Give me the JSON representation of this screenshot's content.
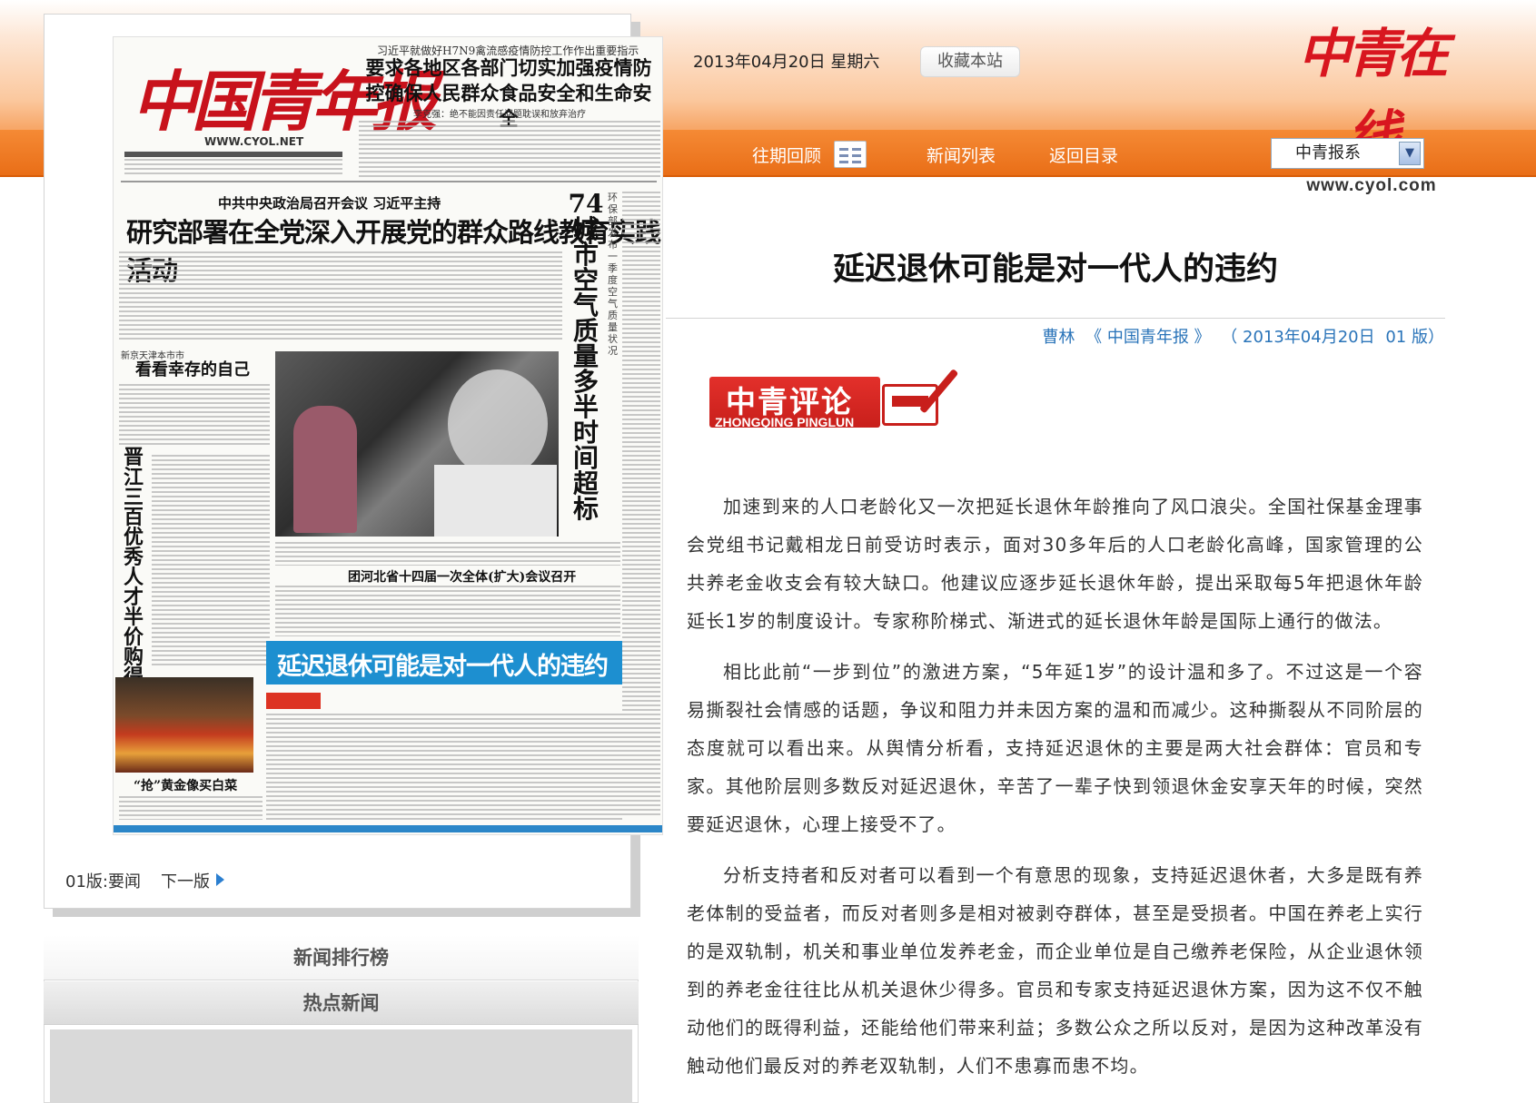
{
  "header": {
    "date": "2013年04月20日  星期六",
    "bookmark_label": "收藏本站",
    "logo_text": "中青在线",
    "logo_url": "www.cyol.com"
  },
  "nav": {
    "items": [
      "往期回顾",
      "新闻列表",
      "返回目录"
    ],
    "select_value": "中青报系"
  },
  "front_page": {
    "masthead": "中国青年报",
    "masthead_url": "WWW.CYOL.NET",
    "lead_kicker": "习近平就做好H7N9禽流感疫情防控工作作出重要指示",
    "lead_headline": "要求各地区各部门切实加强疫情防控确保人民群众食品安全和生命安全",
    "lead_sub": "李克强：绝不能因责任问题耽误和放弃治疗",
    "section_kicker": "中共中央政治局召开会议 习近平主持",
    "section_headline": "研究部署在全党深入开展党的群众路线教育实践活动",
    "side_headline": "74城市空气质量多半时间超标",
    "side_small": "环保部发布一季度空气质量状况",
    "sub_kicker": "新京天津本市市",
    "sub_headline": "看看幸存的自己",
    "left_vertical": "晋江三百优秀人才半价购得保障房",
    "mid_headline": "团河北省十四届一次全体(扩大)会议召开",
    "banner_headline": "延迟退休可能是对一代人的违约",
    "market_caption": "“抢”黄金像买白菜"
  },
  "page_nav": {
    "current": "01版:要闻",
    "next": "下一版"
  },
  "sidebar": {
    "ranking_title": "新闻排行榜",
    "hot_title": "热点新闻"
  },
  "article": {
    "title": "延迟退休可能是对一代人的违约",
    "byline": {
      "author": "曹林",
      "source": "《 中国青年报 》",
      "date": "（ 2013年04月20日",
      "page": "01 版）"
    },
    "logo_cn": "中青评论",
    "logo_pinyin": "ZHONGQING PINGLUN",
    "paragraphs": [
      "加速到来的人口老龄化又一次把延长退休年龄推向了风口浪尖。全国社保基金理事会党组书记戴相龙日前受访时表示，面对30多年后的人口老龄化高峰，国家管理的公共养老金收支会有较大缺口。他建议应逐步延长退休年龄，提出采取每5年把退休年龄延长1岁的制度设计。专家称阶梯式、渐进式的延长退休年龄是国际上通行的做法。",
      "相比此前“一步到位”的激进方案，“5年延1岁”的设计温和多了。不过这是一个容易撕裂社会情感的话题，争议和阻力并未因方案的温和而减少。这种撕裂从不同阶层的态度就可以看出来。从舆情分析看，支持延迟退休的主要是两大社会群体：官员和专家。其他阶层则多数反对延迟退休，辛苦了一辈子快到领退休金安享天年的时候，突然要延迟退休，心理上接受不了。",
      "分析支持者和反对者可以看到一个有意思的现象，支持延迟退休者，大多是既有养老体制的受益者，而反对者则多是相对被剥夺群体，甚至是受损者。中国在养老上实行的是双轨制，机关和事业单位发养老金，而企业单位是自己缴养老保险，从企业退休领到的养老金往往比从机关退休少得多。官员和专家支持延迟退休方案，因为这不仅不触动他们的既得利益，还能给他们带来利益；多数公众之所以反对，是因为这种改革没有触动他们最反对的养老双轨制，人们不患寡而患不均。"
    ]
  }
}
